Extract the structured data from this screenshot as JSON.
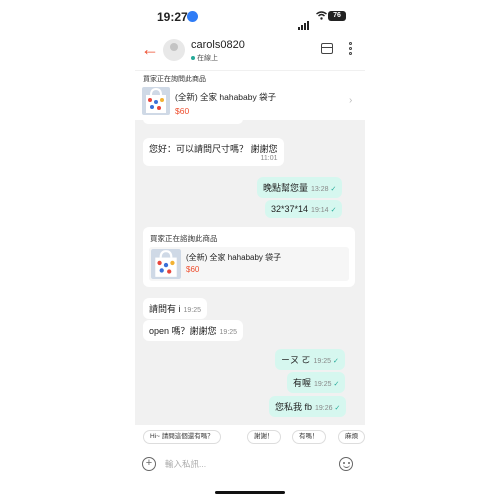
{
  "status_bar": {
    "time": "19:27",
    "battery": "76"
  },
  "header": {
    "username": "carols0820",
    "presence": "在線上"
  },
  "pinned_product": {
    "label": "買家正在詢問此商品",
    "title": "(全新) 全家 hahababy 袋子",
    "price": "$60"
  },
  "messages": [
    {
      "direction": "in",
      "text": "您好：可以請問尺寸嗎？ 謝謝您",
      "time": "11:01"
    },
    {
      "direction": "out",
      "text": "晚點幫您量",
      "time": "13:28",
      "read": "✓"
    },
    {
      "direction": "out",
      "text": "32*37*14",
      "time": "19:14",
      "read": "✓"
    },
    {
      "direction": "in",
      "text": "請問有 i",
      "time": "19:25"
    },
    {
      "direction": "in",
      "text": "open 嗎？謝謝您",
      "time": "19:25"
    },
    {
      "direction": "out",
      "text": "ㄧㄡ ㄛ",
      "time": "19:25",
      "read": "✓"
    },
    {
      "direction": "out",
      "text": "有喔",
      "time": "19:25",
      "read": "✓"
    },
    {
      "direction": "out",
      "text": "您私我 fb",
      "time": "19:26",
      "read": "✓"
    }
  ],
  "product_card": {
    "heading": "買家正在諮詢此商品",
    "title": "(全新) 全家 hahababy 袋子",
    "price": "$60"
  },
  "quick_replies": [
    "Hi~ 請問這個還有嗎？",
    "謝謝！",
    "有嗎！",
    "麻煩"
  ],
  "composer": {
    "placeholder": "輸入私訊..."
  },
  "colors": {
    "brand": "#ee4d2d",
    "outgoing_bubble": "#d6f7ef",
    "chat_bg": "#f1f1f1",
    "read_check": "#26aa99"
  }
}
